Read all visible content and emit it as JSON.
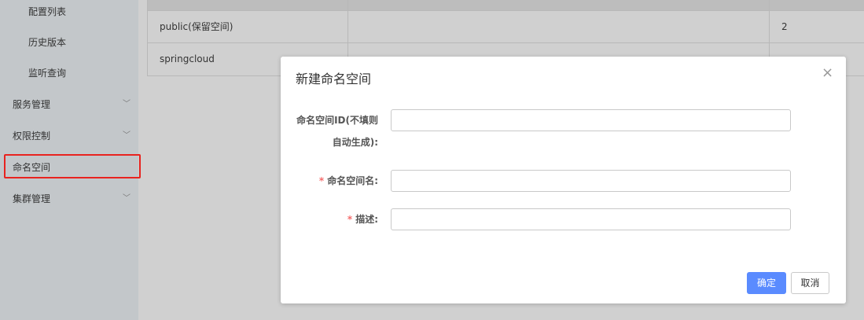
{
  "sidebar": {
    "items": [
      {
        "label": "配置列表"
      },
      {
        "label": "历史版本"
      },
      {
        "label": "监听查询"
      },
      {
        "label": "服务管理"
      },
      {
        "label": "权限控制"
      },
      {
        "label": "命名空间"
      },
      {
        "label": "集群管理"
      }
    ]
  },
  "table": {
    "rows": [
      {
        "name": "public(保留空间)",
        "id": "",
        "count": "2"
      },
      {
        "name": "springcloud",
        "id": "",
        "count": ""
      }
    ]
  },
  "dialog": {
    "title": "新建命名空间",
    "fields": [
      {
        "label_line1": "命名空间ID(不填则",
        "label_line2": "自动生成):",
        "value": "",
        "required": false
      },
      {
        "label": "命名空间名:",
        "value": "",
        "required": true
      },
      {
        "label": "描述:",
        "value": "",
        "required": true
      }
    ],
    "required_mark": "*",
    "close": "×",
    "ok_label": "确定",
    "cancel_label": "取消"
  }
}
